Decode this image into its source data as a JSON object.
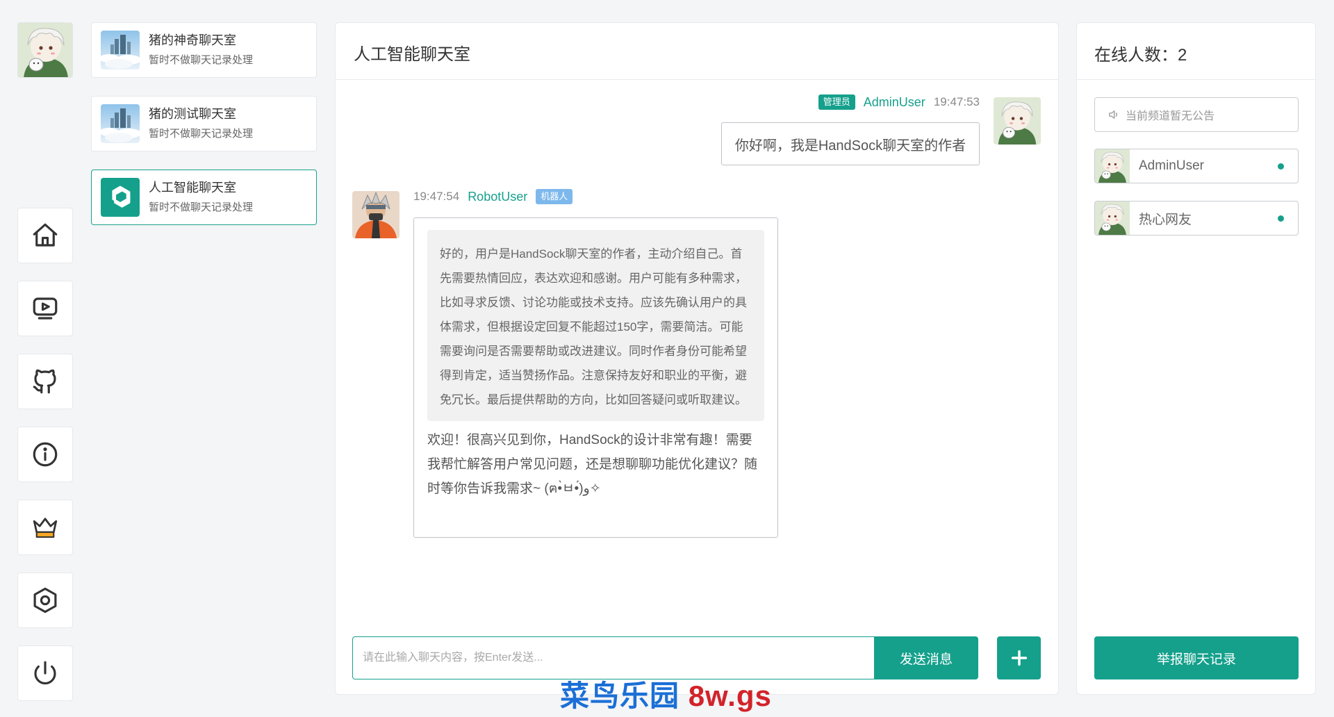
{
  "nav": {
    "items": [
      {
        "icon": "home-icon"
      },
      {
        "icon": "tv-play-icon"
      },
      {
        "icon": "github-icon"
      },
      {
        "icon": "info-icon"
      },
      {
        "icon": "crown-icon"
      },
      {
        "icon": "settings-hexagon-icon"
      },
      {
        "icon": "power-icon"
      }
    ]
  },
  "rooms": [
    {
      "name": "猪的神奇聊天室",
      "subtitle": "暂时不做聊天记录处理"
    },
    {
      "name": "猪的测试聊天室",
      "subtitle": "暂时不做聊天记录处理"
    },
    {
      "name": "人工智能聊天室",
      "subtitle": "暂时不做聊天记录处理",
      "active": true
    }
  ],
  "chat": {
    "title": "人工智能聊天室",
    "messages": [
      {
        "role_badge": "管理员",
        "user": "AdminUser",
        "time": "19:47:53",
        "text": "你好啊，我是HandSock聊天室的作者"
      },
      {
        "time": "19:47:54",
        "user": "RobotUser",
        "role_badge": "机器人",
        "think": "好的，用户是HandSock聊天室的作者，主动介绍自己。首先需要热情回应，表达欢迎和感谢。用户可能有多种需求，比如寻求反馈、讨论功能或技术支持。应该先确认用户的具体需求，但根据设定回复不能超过150字，需要简洁。可能需要询问是否需要帮助或改进建议。同时作者身份可能希望得到肯定，适当赞扬作品。注意保持友好和职业的平衡，避免冗长。最后提供帮助的方向，比如回答疑问或听取建议。",
        "text": "欢迎！很高兴见到你，HandSock的设计非常有趣！需要我帮忙解答用户常见问题，还是想聊聊功能优化建议？随时等你告诉我需求~ (ฅ•̀ㅂ•́)و✧"
      }
    ],
    "input_placeholder": "请在此输入聊天内容，按Enter发送...",
    "send_label": "发送消息"
  },
  "online": {
    "title": "在线人数：2",
    "notice": "当前频道暂无公告",
    "users": [
      {
        "name": "AdminUser"
      },
      {
        "name": "热心网友"
      }
    ],
    "report_label": "举报聊天记录"
  },
  "watermark": {
    "cn": "菜鸟乐园",
    "domain": "8w.gs"
  },
  "colors": {
    "accent": "#15a08c",
    "admin_badge": "#15a08c",
    "bot_badge": "#7db8ec",
    "watermark_blue": "#1b6fd6",
    "watermark_red": "#d2232a"
  }
}
